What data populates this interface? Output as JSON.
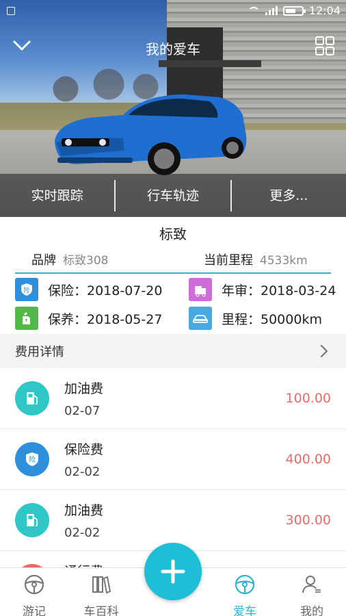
{
  "status": {
    "time": "12:04"
  },
  "header": {
    "title": "我的爱车"
  },
  "quick_actions": [
    "实时跟踪",
    "行车轨迹",
    "更多..."
  ],
  "car": {
    "name": "标致",
    "brand_label": "品牌",
    "brand_value": "标致308",
    "mileage_label": "当前里程",
    "mileage_value": "4533km"
  },
  "reminders": [
    {
      "text": "保险：2018-07-20",
      "icon": "insurance-icon",
      "color": "#2e8fdc"
    },
    {
      "text": "年审：2018-03-24",
      "icon": "inspection-icon",
      "color": "#cf6cd8"
    },
    {
      "text": "保养：2018-05-27",
      "icon": "maintenance-icon",
      "color": "#52b848"
    },
    {
      "text": "里程：50000km",
      "icon": "car-mileage-icon",
      "color": "#47a9e0"
    }
  ],
  "expenses": {
    "title": "费用详情",
    "items": [
      {
        "name": "加油费",
        "date": "02-07",
        "amount": "100.00",
        "icon": "fuel-icon",
        "color": "#2ec6c6"
      },
      {
        "name": "保险费",
        "date": "02-02",
        "amount": "400.00",
        "icon": "insurance-icon",
        "color": "#2e8fdc"
      },
      {
        "name": "加油费",
        "date": "02-02",
        "amount": "300.00",
        "icon": "fuel-icon",
        "color": "#2ec6c6"
      },
      {
        "name": "通行费",
        "date": "",
        "amount": "",
        "icon": "toll-icon",
        "color": "#ee6a6a"
      }
    ]
  },
  "tabs": [
    {
      "label": "游记",
      "icon": "steering-wheel-icon",
      "active": false
    },
    {
      "label": "车百科",
      "icon": "books-icon",
      "active": false
    },
    {
      "label": "爱车",
      "icon": "steering-wheel-icon",
      "active": true
    },
    {
      "label": "我的",
      "icon": "user-icon",
      "active": false
    }
  ],
  "accent_color": "#29b6d2",
  "amount_color": "#ee6a6a"
}
